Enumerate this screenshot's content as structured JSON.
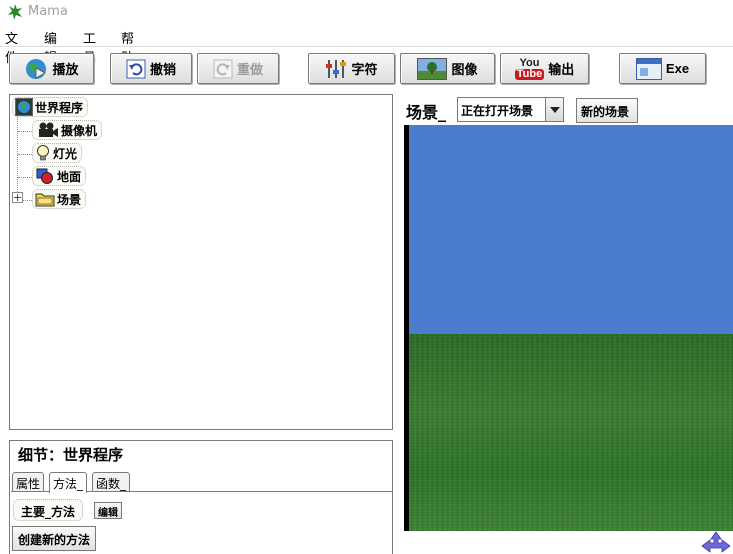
{
  "window": {
    "title": "Mama"
  },
  "menu": {
    "items": [
      "文件",
      "编辑",
      "工具",
      "帮助"
    ]
  },
  "toolbar": {
    "play": "播放",
    "undo": "撤销",
    "redo": "重做",
    "font": "字符",
    "image": "图像",
    "youtube_logo": "You Tube",
    "export": "输出",
    "exe": "Exe"
  },
  "tree": {
    "root": "世界程序",
    "children": [
      "摄像机",
      "灯光",
      "地面",
      "场景"
    ],
    "icons": [
      "globe-icon",
      "camera-icon",
      "light-bulb-icon",
      "ground-shape-icon",
      "folder-icon"
    ]
  },
  "details": {
    "title": "细节：世界程序",
    "tabs": [
      "属性",
      "方法_",
      "函数_"
    ],
    "active_tab": "方法_",
    "method": "主要_方法",
    "edit": "编辑",
    "create": "创建新的方法"
  },
  "scene": {
    "label": "场景_",
    "selected": "正在打开场景",
    "new_scene": "新的场景"
  },
  "colors": {
    "sky": "#4b7ccd",
    "ground": "#2f7328",
    "youtube": "#cc181e"
  }
}
